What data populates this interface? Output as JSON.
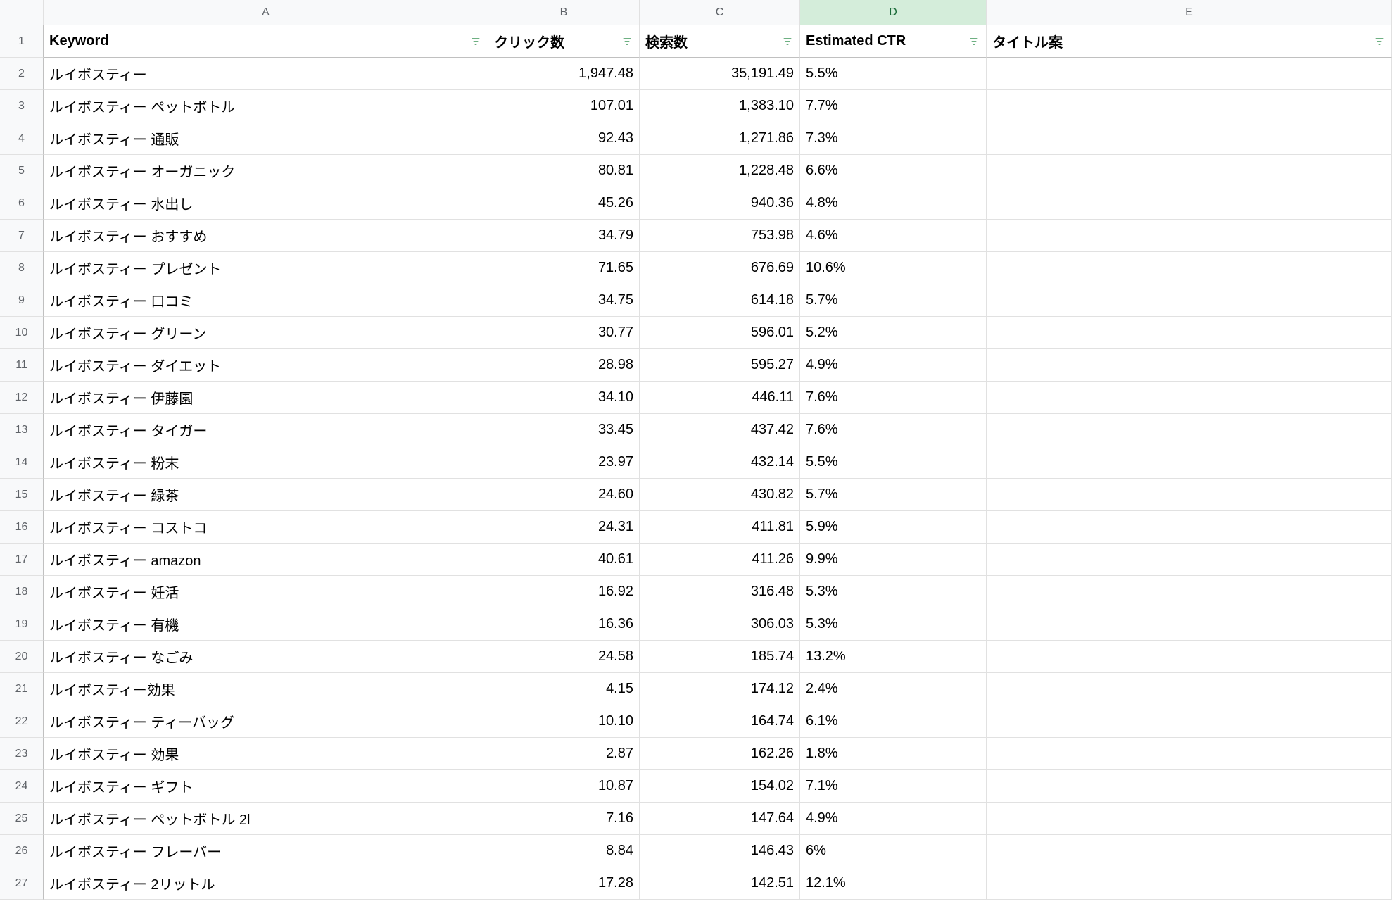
{
  "columns": [
    "A",
    "B",
    "C",
    "D",
    "E"
  ],
  "selectedColumn": "D",
  "headers": {
    "A": "Keyword",
    "B": "クリック数",
    "C": "検索数",
    "D": "Estimated CTR",
    "E": "タイトル案"
  },
  "rows": [
    {
      "n": 2,
      "keyword": "ルイボスティー",
      "clicks": "1,947.48",
      "searches": "35,191.49",
      "ctr": "5.5%",
      "title": ""
    },
    {
      "n": 3,
      "keyword": "ルイボスティー ペットボトル",
      "clicks": "107.01",
      "searches": "1,383.10",
      "ctr": "7.7%",
      "title": ""
    },
    {
      "n": 4,
      "keyword": "ルイボスティー 通販",
      "clicks": "92.43",
      "searches": "1,271.86",
      "ctr": "7.3%",
      "title": ""
    },
    {
      "n": 5,
      "keyword": "ルイボスティー オーガニック",
      "clicks": "80.81",
      "searches": "1,228.48",
      "ctr": "6.6%",
      "title": ""
    },
    {
      "n": 6,
      "keyword": "ルイボスティー 水出し",
      "clicks": "45.26",
      "searches": "940.36",
      "ctr": "4.8%",
      "title": ""
    },
    {
      "n": 7,
      "keyword": "ルイボスティー おすすめ",
      "clicks": "34.79",
      "searches": "753.98",
      "ctr": "4.6%",
      "title": ""
    },
    {
      "n": 8,
      "keyword": "ルイボスティー プレゼント",
      "clicks": "71.65",
      "searches": "676.69",
      "ctr": "10.6%",
      "title": ""
    },
    {
      "n": 9,
      "keyword": "ルイボスティー 口コミ",
      "clicks": "34.75",
      "searches": "614.18",
      "ctr": "5.7%",
      "title": ""
    },
    {
      "n": 10,
      "keyword": "ルイボスティー グリーン",
      "clicks": "30.77",
      "searches": "596.01",
      "ctr": "5.2%",
      "title": ""
    },
    {
      "n": 11,
      "keyword": "ルイボスティー ダイエット",
      "clicks": "28.98",
      "searches": "595.27",
      "ctr": "4.9%",
      "title": ""
    },
    {
      "n": 12,
      "keyword": "ルイボスティー 伊藤園",
      "clicks": "34.10",
      "searches": "446.11",
      "ctr": "7.6%",
      "title": ""
    },
    {
      "n": 13,
      "keyword": "ルイボスティー タイガー",
      "clicks": "33.45",
      "searches": "437.42",
      "ctr": "7.6%",
      "title": ""
    },
    {
      "n": 14,
      "keyword": "ルイボスティー 粉末",
      "clicks": "23.97",
      "searches": "432.14",
      "ctr": "5.5%",
      "title": ""
    },
    {
      "n": 15,
      "keyword": "ルイボスティー 緑茶",
      "clicks": "24.60",
      "searches": "430.82",
      "ctr": "5.7%",
      "title": ""
    },
    {
      "n": 16,
      "keyword": "ルイボスティー コストコ",
      "clicks": "24.31",
      "searches": "411.81",
      "ctr": "5.9%",
      "title": ""
    },
    {
      "n": 17,
      "keyword": "ルイボスティー amazon",
      "clicks": "40.61",
      "searches": "411.26",
      "ctr": "9.9%",
      "title": ""
    },
    {
      "n": 18,
      "keyword": "ルイボスティー 妊活",
      "clicks": "16.92",
      "searches": "316.48",
      "ctr": "5.3%",
      "title": ""
    },
    {
      "n": 19,
      "keyword": "ルイボスティー 有機",
      "clicks": "16.36",
      "searches": "306.03",
      "ctr": "5.3%",
      "title": ""
    },
    {
      "n": 20,
      "keyword": "ルイボスティー なごみ",
      "clicks": "24.58",
      "searches": "185.74",
      "ctr": "13.2%",
      "title": ""
    },
    {
      "n": 21,
      "keyword": "ルイボスティー効果",
      "clicks": "4.15",
      "searches": "174.12",
      "ctr": "2.4%",
      "title": ""
    },
    {
      "n": 22,
      "keyword": "ルイボスティー ティーバッグ",
      "clicks": "10.10",
      "searches": "164.74",
      "ctr": "6.1%",
      "title": ""
    },
    {
      "n": 23,
      "keyword": "ルイボスティー 効果",
      "clicks": "2.87",
      "searches": "162.26",
      "ctr": "1.8%",
      "title": ""
    },
    {
      "n": 24,
      "keyword": "ルイボスティー ギフト",
      "clicks": "10.87",
      "searches": "154.02",
      "ctr": "7.1%",
      "title": ""
    },
    {
      "n": 25,
      "keyword": "ルイボスティー ペットボトル 2l",
      "clicks": "7.16",
      "searches": "147.64",
      "ctr": "4.9%",
      "title": ""
    },
    {
      "n": 26,
      "keyword": "ルイボスティー フレーバー",
      "clicks": "8.84",
      "searches": "146.43",
      "ctr": "6%",
      "title": ""
    },
    {
      "n": 27,
      "keyword": "ルイボスティー 2リットル",
      "clicks": "17.28",
      "searches": "142.51",
      "ctr": "12.1%",
      "title": ""
    }
  ]
}
